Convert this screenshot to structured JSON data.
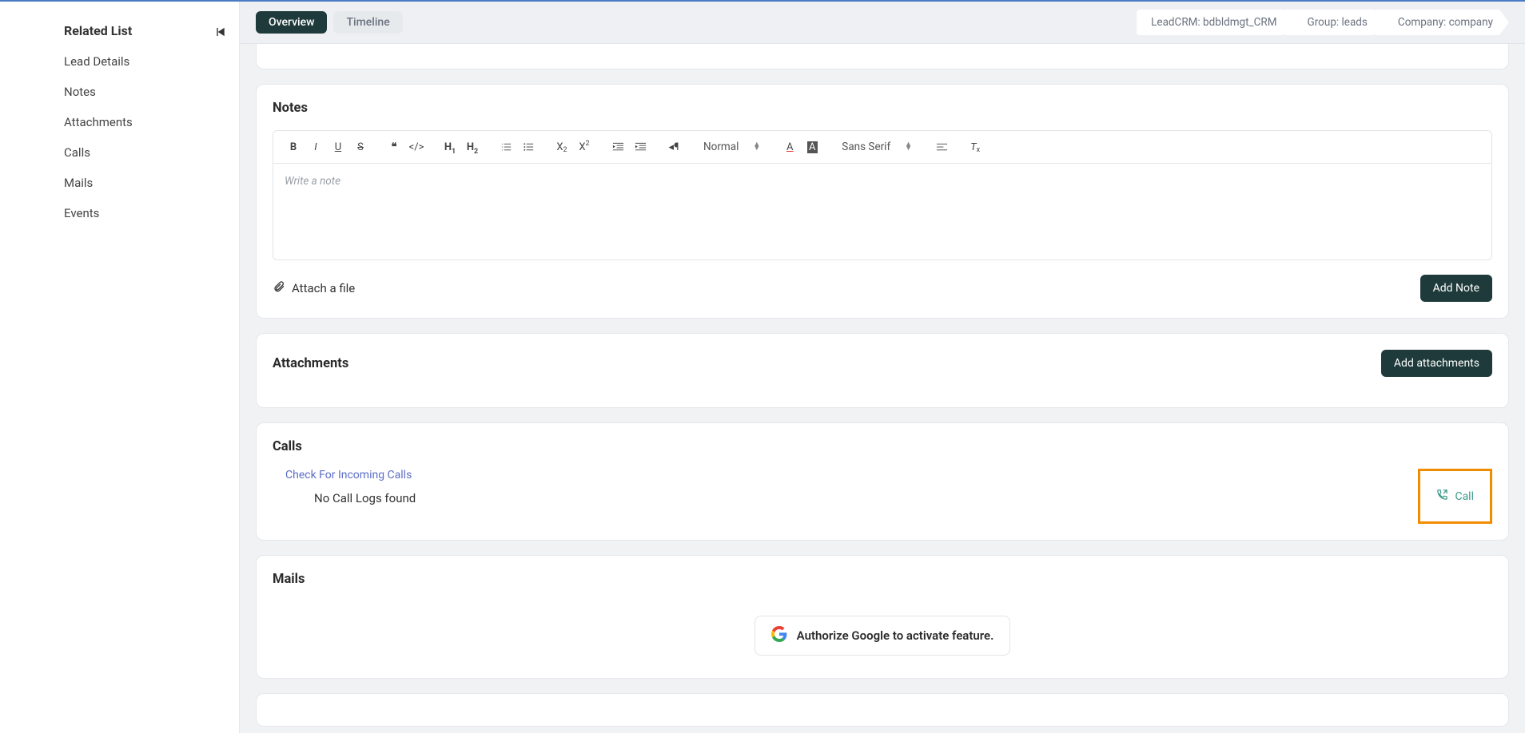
{
  "sidebar": {
    "title": "Related List",
    "items": [
      {
        "label": "Lead Details"
      },
      {
        "label": "Notes"
      },
      {
        "label": "Attachments"
      },
      {
        "label": "Calls"
      },
      {
        "label": "Mails"
      },
      {
        "label": "Events"
      }
    ]
  },
  "tabs": {
    "overview": "Overview",
    "timeline": "Timeline"
  },
  "breadcrumbs": {
    "crm": "LeadCRM: bdbldmgt_CRM",
    "group": "Group: leads",
    "company": "Company: company"
  },
  "notes": {
    "title": "Notes",
    "placeholder": "Write a note",
    "attach_label": "Attach a file",
    "add_button": "Add Note",
    "toolbar": {
      "normal": "Normal",
      "font": "Sans Serif"
    }
  },
  "attachments": {
    "title": "Attachments",
    "add_button": "Add attachments"
  },
  "calls": {
    "title": "Calls",
    "check_link": "Check For Incoming Calls",
    "empty": "No Call Logs found",
    "call_button": "Call"
  },
  "mails": {
    "title": "Mails",
    "authorize": "Authorize Google to activate feature."
  }
}
